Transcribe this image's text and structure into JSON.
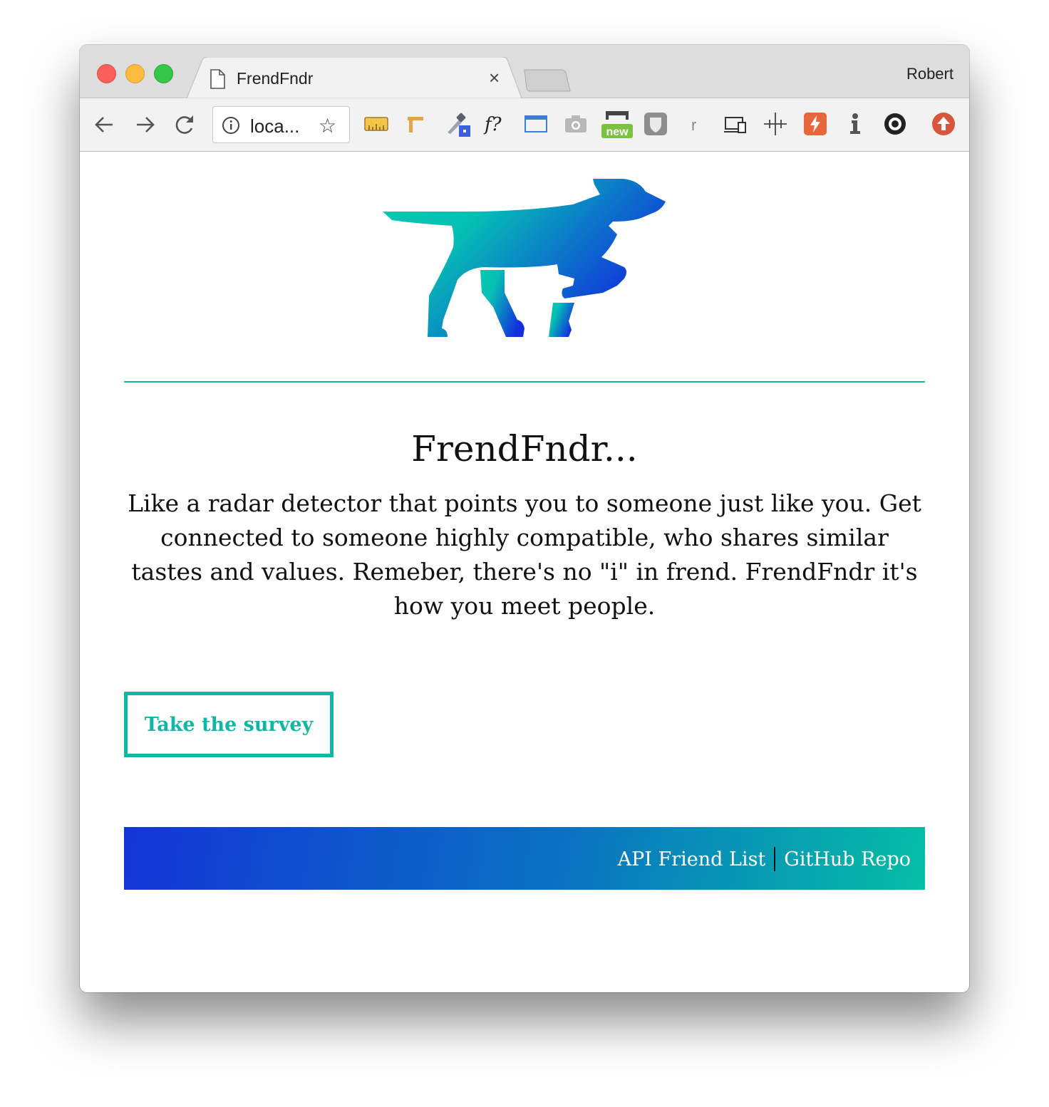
{
  "browser": {
    "tab_title": "FrendFndr",
    "tab_close": "×",
    "profile_name": "Robert",
    "url": "loca...",
    "star": "☆"
  },
  "extensions": [
    "ruler-icon",
    "measure-icon",
    "color-picker-icon",
    "font-identify-icon",
    "window-resize-icon",
    "screenshot-camera-icon",
    "new-badge-icon",
    "shield-icon",
    "r-icon",
    "responsive-devices-icon",
    "move-cross-icon",
    "lightning-icon",
    "info-figure-icon",
    "gear-icon",
    "upload-arrow-icon"
  ],
  "extension_badge": "new",
  "extension_r": "r",
  "extension_fq": "f?",
  "page": {
    "heading": "FrendFndr...",
    "tagline": "Like a radar detector that points you to someone just like you. Get connected to someone highly compatible, who shares similar tastes and values. Remeber, there's no \"i\" in frend. FrendFndr it's how you meet people.",
    "survey_button": "Take the survey",
    "footer_links": {
      "api": "API Friend List",
      "github": "GitHub Repo"
    }
  },
  "colors": {
    "accent_teal": "#0eb8a5",
    "brand_blue": "#1435d6"
  }
}
